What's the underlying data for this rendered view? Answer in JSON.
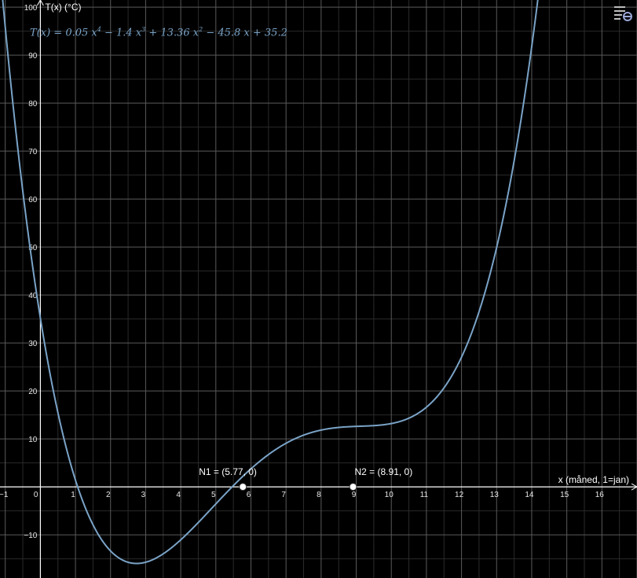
{
  "chart_data": {
    "type": "line",
    "function_label": "T(x) = 0.05 x^4 − 1.4 x^3 + 13.36 x^2 − 45.8 x + 35.2",
    "coefficients": {
      "a4": 0.05,
      "a3": -1.4,
      "a2": 13.36,
      "a1": -45.8,
      "a0": 35.2
    },
    "xlabel": "x (måned, 1=jan)",
    "ylabel": "T(x) (°C)",
    "xlim": [
      -1.15,
      17.0
    ],
    "ylim": [
      -19.0,
      101.5
    ],
    "x_ticks": [
      -1,
      0,
      1,
      2,
      3,
      4,
      5,
      6,
      7,
      8,
      9,
      10,
      11,
      12,
      13,
      14,
      15,
      16
    ],
    "y_ticks": [
      -10,
      10,
      20,
      30,
      40,
      50,
      60,
      70,
      80,
      90,
      100
    ],
    "grid": true,
    "points": [
      {
        "name": "N1",
        "x": 5.77,
        "y": 0,
        "label": "N1 = (5.77, 0)"
      },
      {
        "name": "N2",
        "x": 8.91,
        "y": 0,
        "label": "N2 = (8.91, 0)"
      }
    ],
    "colors": {
      "curve": "#7aa3c7",
      "background": "#000000",
      "grid_major": "#5a5a5a",
      "grid_minor": "#2a2a2a",
      "axis": "#ffffff"
    }
  },
  "formula": {
    "T": "T(x)",
    "eq": "=",
    "c4": "0.05 x",
    "e4": "4",
    "c3": " − 1.4 x",
    "e3": "3",
    "c2": " + 13.36 x",
    "e2": "2",
    "rest": " − 45.8 x + 35.2"
  },
  "icons": {
    "settings": "graphics-settings-icon"
  }
}
